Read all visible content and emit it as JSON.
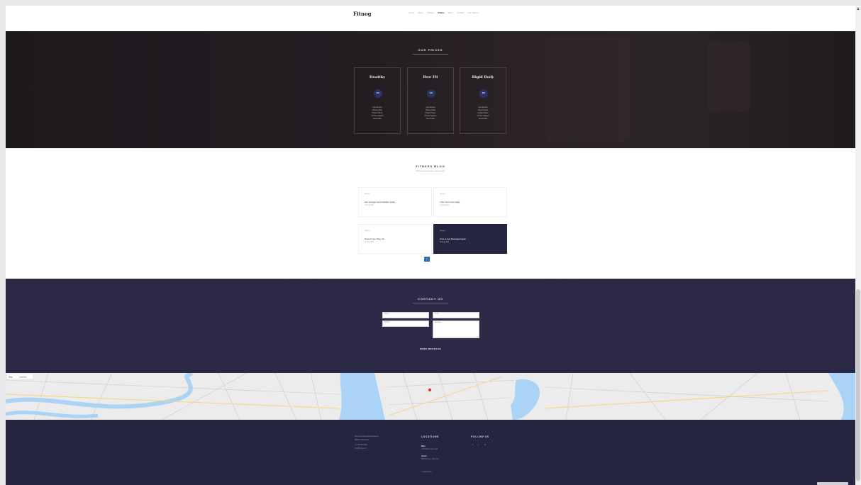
{
  "header": {
    "logo": "Fitnog",
    "nav": [
      "Home",
      "About",
      "Classes",
      "Prices",
      "Team",
      "Contact",
      "Get Started"
    ],
    "active_index": 3
  },
  "plans": {
    "title": "OUR PRICES",
    "cards": [
      {
        "name": "Healthy",
        "price": "$30",
        "features": [
          "Gym Access",
          "Fitness Class",
          "Private Trainer",
          "24 Hour Support",
          "Free Drinks"
        ]
      },
      {
        "name": "Bwe Fit",
        "price": "$40",
        "features": [
          "Gym Access",
          "Fitness Class",
          "Private Trainer",
          "24 Hour Support",
          "Free Drinks"
        ]
      },
      {
        "name": "Rigid Body",
        "price": "$50",
        "features": [
          "Gym Access",
          "Fitness Class",
          "Private Trainer",
          "24 Hour Support",
          "Free Drinks"
        ]
      }
    ]
  },
  "blog": {
    "title": "FITNESS BLOG",
    "subtitle": "Read our latest fitness news and tips",
    "posts": [
      {
        "category": "Fitness",
        "title": "Get stronger and healthier today",
        "date": "12 Aug 2016"
      },
      {
        "category": "Fitness",
        "title": "Train Your Core Daily",
        "date": "12 Aug 2016"
      },
      {
        "category": "Fitness",
        "title": "Stretch Your Way Up",
        "date": "12 Aug 2016"
      },
      {
        "category": "Fitness",
        "title": "How to Get Motivated Again",
        "date": "12 Aug 2016"
      }
    ],
    "page": "1"
  },
  "contact": {
    "title": "CONTACT US",
    "fields": {
      "name": "Name",
      "email": "Email",
      "subject": "Subject",
      "message": "Message"
    },
    "send": "SEND MESSAGE"
  },
  "map": {
    "labels": [
      "Map",
      "Satellite"
    ]
  },
  "footer": {
    "about_lines": [
      "Fitnog is a fitness studio based in",
      "Midtown Manhattan.",
      "+1 212 555 0199",
      "info@fitnog.com"
    ],
    "locations_title": "LOCATIONS",
    "loc1_label": "Main",
    "loc1_text": "123 5th Ave, New York",
    "loc2_label": "Annex",
    "loc2_text": "456 Park Ave, New York",
    "copyright": "© 2016 Fitnog",
    "follow_title": "FOLLOW US",
    "social": [
      "f",
      "t",
      "in"
    ]
  },
  "colors": {
    "accent": "#2f6cb0",
    "dark_navy": "#25253f",
    "price_badge": "#2d3266",
    "map_water": "#aad3f5",
    "map_marker": "#e53935"
  }
}
